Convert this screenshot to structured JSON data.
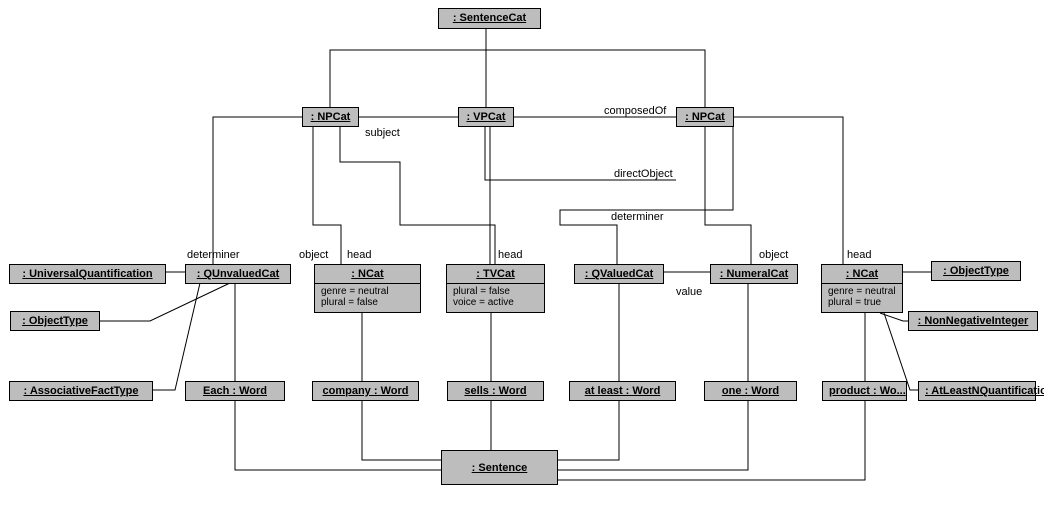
{
  "nodes": {
    "sentenceCat": {
      "title": ": SentenceCat"
    },
    "npCat1": {
      "title": ": NPCat"
    },
    "vpCat": {
      "title": ": VPCat"
    },
    "npCat2": {
      "title": ": NPCat"
    },
    "universalQuant": {
      "title": ": UniversalQuantification"
    },
    "qUnvaluedCat": {
      "title": ": QUnvaluedCat"
    },
    "nCat1": {
      "title": ": NCat",
      "attr1": "genre = neutral",
      "attr2": "plural = false"
    },
    "tvCat": {
      "title": ": TVCat",
      "attr1": "plural = false",
      "attr2": "voice = active"
    },
    "qValuedCat": {
      "title": ": QValuedCat"
    },
    "numeralCat": {
      "title": ": NumeralCat"
    },
    "nCat2": {
      "title": ": NCat",
      "attr1": "genre = neutral",
      "attr2": "plural = true"
    },
    "objectType1": {
      "title": ": ObjectType"
    },
    "objectType2": {
      "title": ": ObjectType"
    },
    "nonNegInt": {
      "title": ": NonNegativeInteger"
    },
    "assocFactType": {
      "title": ": AssociativeFactType"
    },
    "eachWord": {
      "title": "Each : Word"
    },
    "companyWord": {
      "title": "company : Word"
    },
    "sellsWord": {
      "title": "sells : Word"
    },
    "atLeastWord": {
      "title": "at least : Word"
    },
    "oneWord": {
      "title": "one : Word"
    },
    "productWord": {
      "title": "product : Wo..."
    },
    "atLeastNQuant": {
      "title": ": AtLeastNQuantification"
    },
    "sentence": {
      "title": ": Sentence"
    }
  },
  "labels": {
    "subject": "subject",
    "composedOf": "composedOf",
    "directObject": "directObject",
    "determiner1": "determiner",
    "object1": "object",
    "head1": "head",
    "head2": "head",
    "determiner2": "determiner",
    "object2": "object",
    "head3": "head",
    "value": "value"
  }
}
